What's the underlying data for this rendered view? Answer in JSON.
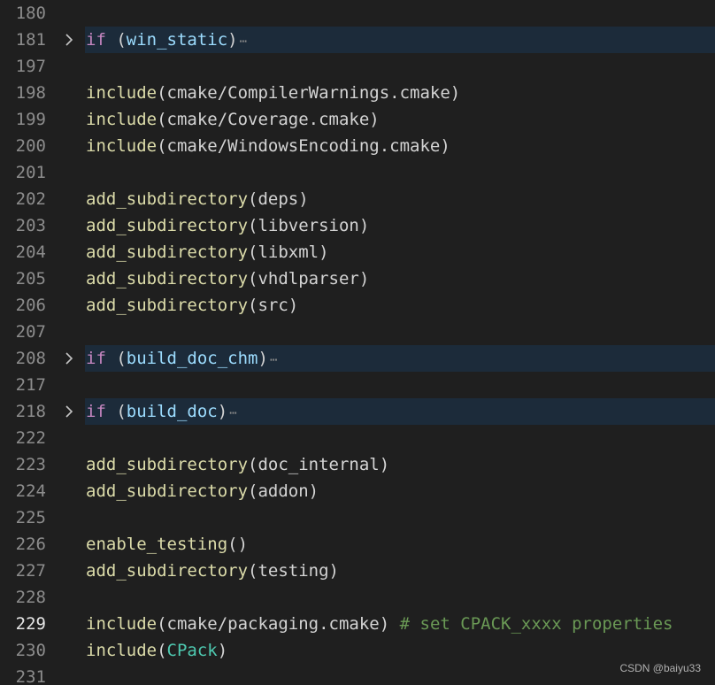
{
  "editor": {
    "lines": [
      {
        "num": "180",
        "folded": false,
        "tokens": []
      },
      {
        "num": "181",
        "folded": true,
        "tokens": [
          {
            "t": "if",
            "c": "kw"
          },
          {
            "t": " (",
            "c": "plain"
          },
          {
            "t": "win_static",
            "c": "var"
          },
          {
            "t": ")",
            "c": "plain"
          }
        ]
      },
      {
        "num": "197",
        "folded": false,
        "tokens": []
      },
      {
        "num": "198",
        "folded": false,
        "tokens": [
          {
            "t": "include",
            "c": "fn"
          },
          {
            "t": "(cmake/CompilerWarnings.cmake)",
            "c": "plain"
          }
        ]
      },
      {
        "num": "199",
        "folded": false,
        "tokens": [
          {
            "t": "include",
            "c": "fn"
          },
          {
            "t": "(cmake/Coverage.cmake)",
            "c": "plain"
          }
        ]
      },
      {
        "num": "200",
        "folded": false,
        "tokens": [
          {
            "t": "include",
            "c": "fn"
          },
          {
            "t": "(cmake/WindowsEncoding.cmake)",
            "c": "plain"
          }
        ]
      },
      {
        "num": "201",
        "folded": false,
        "tokens": []
      },
      {
        "num": "202",
        "folded": false,
        "tokens": [
          {
            "t": "add_subdirectory",
            "c": "fn"
          },
          {
            "t": "(deps)",
            "c": "plain"
          }
        ]
      },
      {
        "num": "203",
        "folded": false,
        "tokens": [
          {
            "t": "add_subdirectory",
            "c": "fn"
          },
          {
            "t": "(libversion)",
            "c": "plain"
          }
        ]
      },
      {
        "num": "204",
        "folded": false,
        "tokens": [
          {
            "t": "add_subdirectory",
            "c": "fn"
          },
          {
            "t": "(libxml)",
            "c": "plain"
          }
        ]
      },
      {
        "num": "205",
        "folded": false,
        "tokens": [
          {
            "t": "add_subdirectory",
            "c": "fn"
          },
          {
            "t": "(vhdlparser)",
            "c": "plain"
          }
        ]
      },
      {
        "num": "206",
        "folded": false,
        "tokens": [
          {
            "t": "add_subdirectory",
            "c": "fn"
          },
          {
            "t": "(src)",
            "c": "plain"
          }
        ]
      },
      {
        "num": "207",
        "folded": false,
        "tokens": []
      },
      {
        "num": "208",
        "folded": true,
        "tokens": [
          {
            "t": "if",
            "c": "kw"
          },
          {
            "t": " (",
            "c": "plain"
          },
          {
            "t": "build_doc_chm",
            "c": "var"
          },
          {
            "t": ")",
            "c": "plain"
          }
        ]
      },
      {
        "num": "217",
        "folded": false,
        "tokens": []
      },
      {
        "num": "218",
        "folded": true,
        "tokens": [
          {
            "t": "if",
            "c": "kw"
          },
          {
            "t": " (",
            "c": "plain"
          },
          {
            "t": "build_doc",
            "c": "var"
          },
          {
            "t": ")",
            "c": "plain"
          }
        ]
      },
      {
        "num": "222",
        "folded": false,
        "tokens": []
      },
      {
        "num": "223",
        "folded": false,
        "tokens": [
          {
            "t": "add_subdirectory",
            "c": "fn"
          },
          {
            "t": "(doc_internal)",
            "c": "plain"
          }
        ]
      },
      {
        "num": "224",
        "folded": false,
        "tokens": [
          {
            "t": "add_subdirectory",
            "c": "fn"
          },
          {
            "t": "(addon)",
            "c": "plain"
          }
        ]
      },
      {
        "num": "225",
        "folded": false,
        "tokens": []
      },
      {
        "num": "226",
        "folded": false,
        "tokens": [
          {
            "t": "enable_testing",
            "c": "fn"
          },
          {
            "t": "()",
            "c": "plain"
          }
        ]
      },
      {
        "num": "227",
        "folded": false,
        "tokens": [
          {
            "t": "add_subdirectory",
            "c": "fn"
          },
          {
            "t": "(testing)",
            "c": "plain"
          }
        ]
      },
      {
        "num": "228",
        "folded": false,
        "tokens": []
      },
      {
        "num": "229",
        "folded": false,
        "current": true,
        "tokens": [
          {
            "t": "include",
            "c": "fn"
          },
          {
            "t": "(cmake/packaging.cmake) ",
            "c": "plain"
          },
          {
            "t": "# set CPACK_xxxx properties",
            "c": "comment"
          }
        ]
      },
      {
        "num": "230",
        "folded": false,
        "tokens": [
          {
            "t": "include",
            "c": "fn"
          },
          {
            "t": "(",
            "c": "plain"
          },
          {
            "t": "CPack",
            "c": "type"
          },
          {
            "t": ")",
            "c": "plain"
          }
        ]
      },
      {
        "num": "231",
        "folded": false,
        "tokens": []
      }
    ],
    "fold_ellipsis": "⋯"
  },
  "watermark": "CSDN @baiyu33",
  "colors": {
    "background": "#1f1f1f",
    "folded_line_bg": "#1c2b3a",
    "keyword": "#c586c0",
    "function": "#dcdcaa",
    "variable": "#9cdcfe",
    "comment": "#6a9955",
    "type": "#4ec9b0"
  }
}
